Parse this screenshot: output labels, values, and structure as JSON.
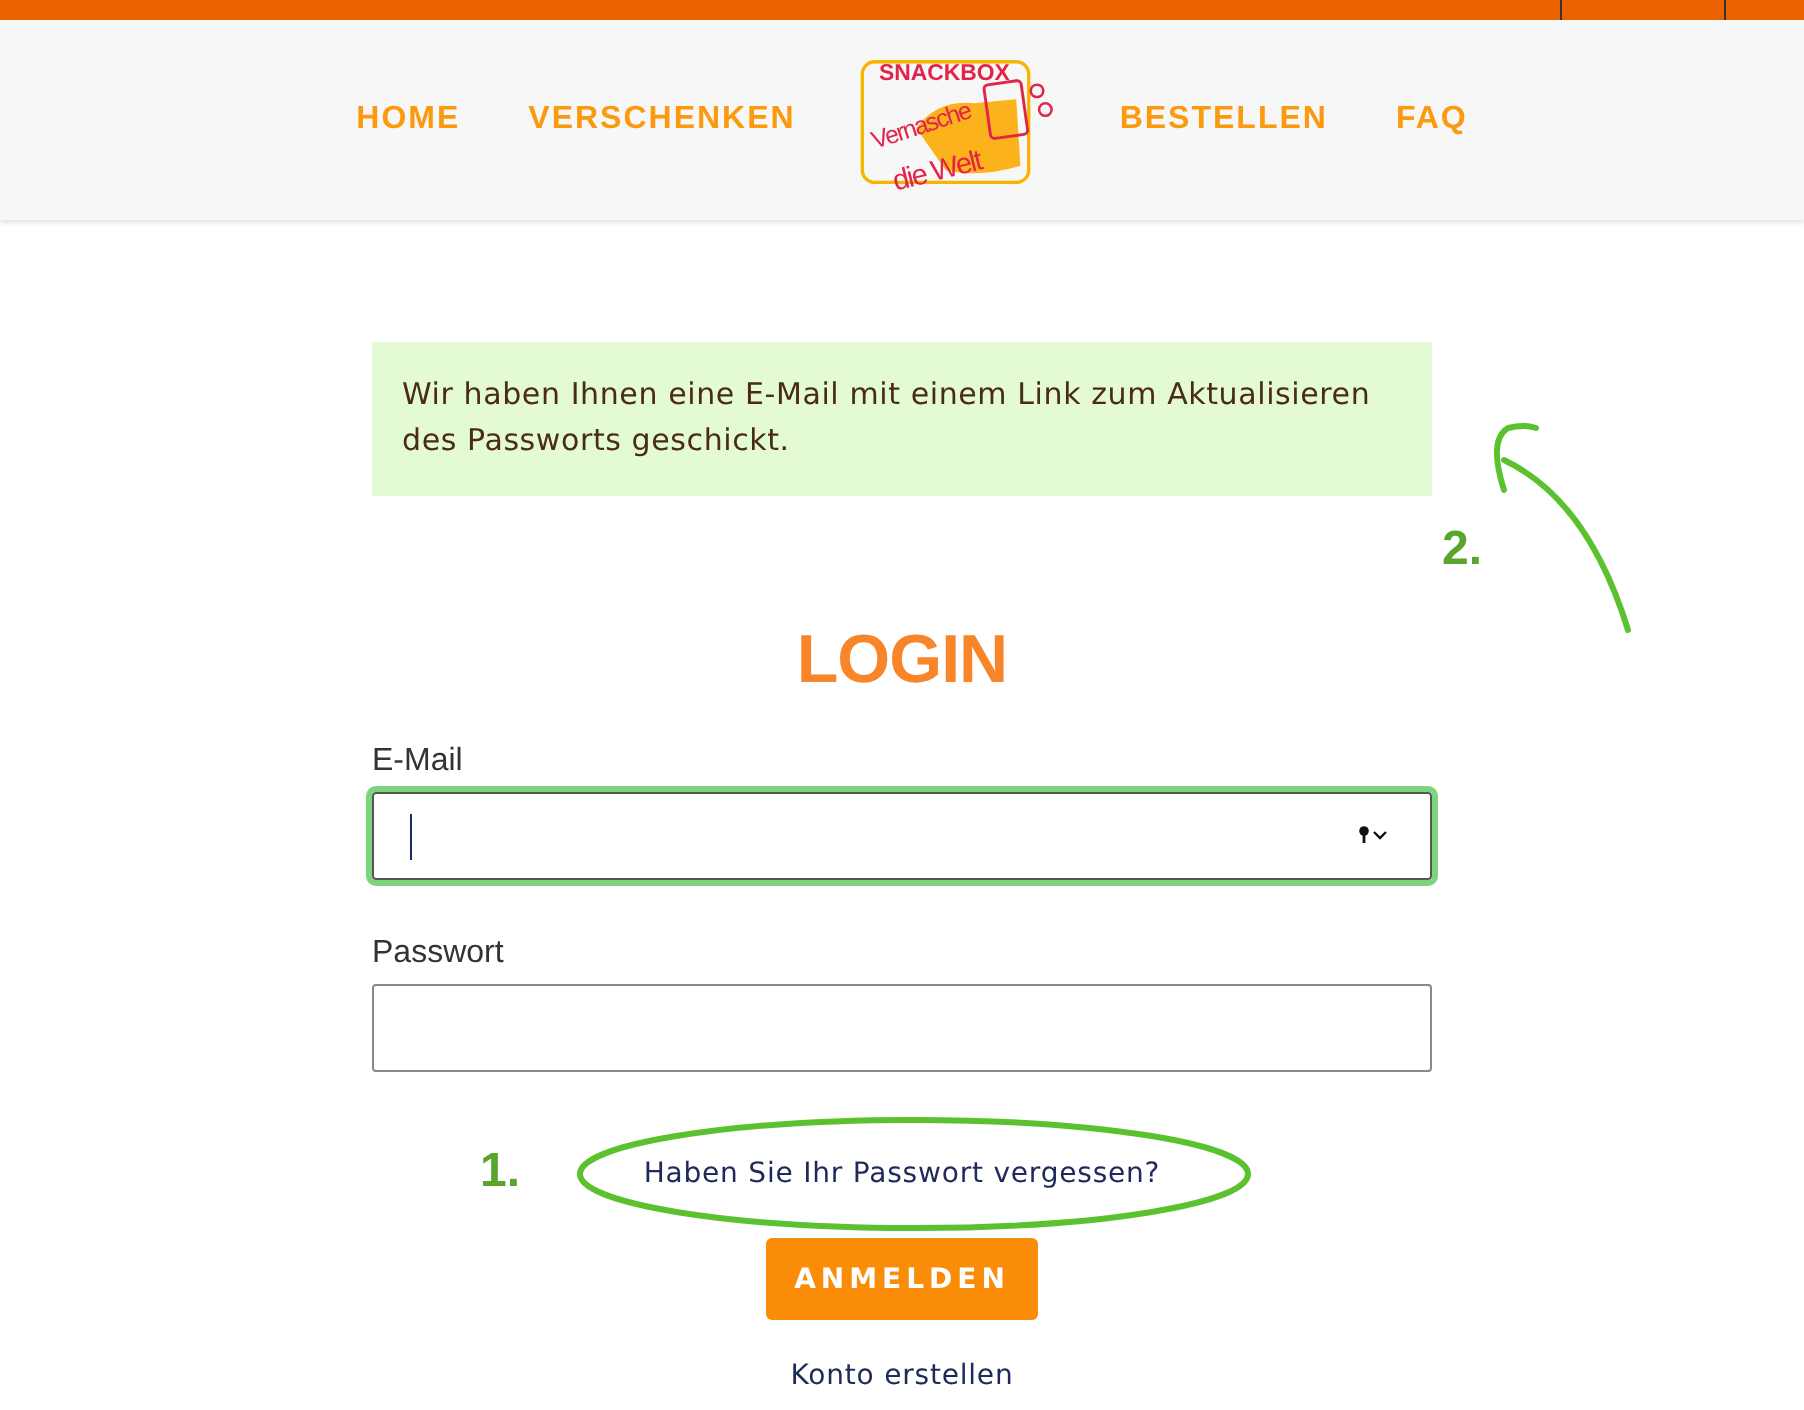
{
  "nav": {
    "left": [
      {
        "label": "HOME"
      },
      {
        "label": "VERSCHENKEN"
      }
    ],
    "right": [
      {
        "label": "BESTELLEN"
      },
      {
        "label": "FAQ"
      }
    ],
    "logo": {
      "top": "SNACKBOX",
      "line1": "Vernasche",
      "line2": "die Welt"
    }
  },
  "message": "Wir haben Ihnen eine E-Mail mit einem Link zum Aktualisieren des Passworts geschickt.",
  "login": {
    "title": "LOGIN",
    "fields": [
      {
        "label": "E-Mail",
        "focused": true,
        "kind": "email"
      },
      {
        "label": "Passwort",
        "focused": false,
        "kind": "password"
      }
    ],
    "forgot_link": "Haben Sie Ihr Passwort vergessen?",
    "submit": "ANMELDEN",
    "create_link": "Konto erstellen"
  },
  "annotations": [
    {
      "label": "1.",
      "kind": "ellipse"
    },
    {
      "label": "2.",
      "kind": "arrow"
    }
  ]
}
